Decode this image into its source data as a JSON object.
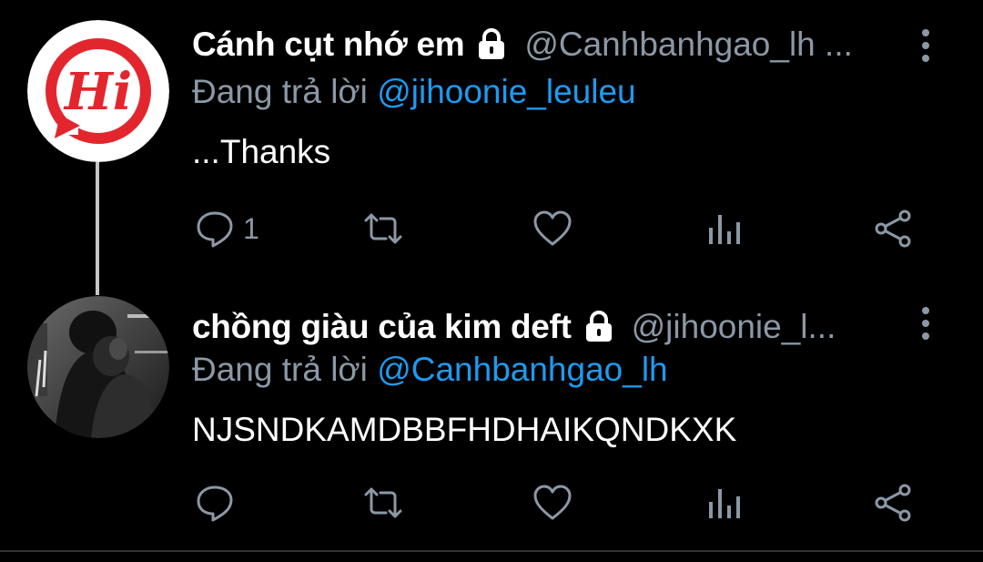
{
  "tweets": [
    {
      "display_name": "Cánh cụt nhớ em",
      "handle": "@Canhbanhgao_lh ...",
      "reply_prefix": "Đang trả lời",
      "reply_to": "@jihoonie_leuleu",
      "text": "...Thanks",
      "avatar_text": "Hi",
      "avatar_icon": "hi-logo-avatar",
      "counts": {
        "reply": "1",
        "retweet": "",
        "like": ""
      }
    },
    {
      "display_name": "chồng giàu của kim deft",
      "handle": "@jihoonie_l...",
      "reply_prefix": "Đang trả lời",
      "reply_to": "@Canhbanhgao_lh",
      "text": "NJSNDKAMDBBFHDHAIKQNDKXK",
      "avatar_icon": "photo-avatar",
      "counts": {
        "reply": "",
        "retweet": "",
        "like": ""
      }
    }
  ],
  "colors": {
    "background": "#000000",
    "secondary_text": "#8b98a5",
    "mention": "#1d9bf0",
    "avatar_red": "#e3262e"
  }
}
